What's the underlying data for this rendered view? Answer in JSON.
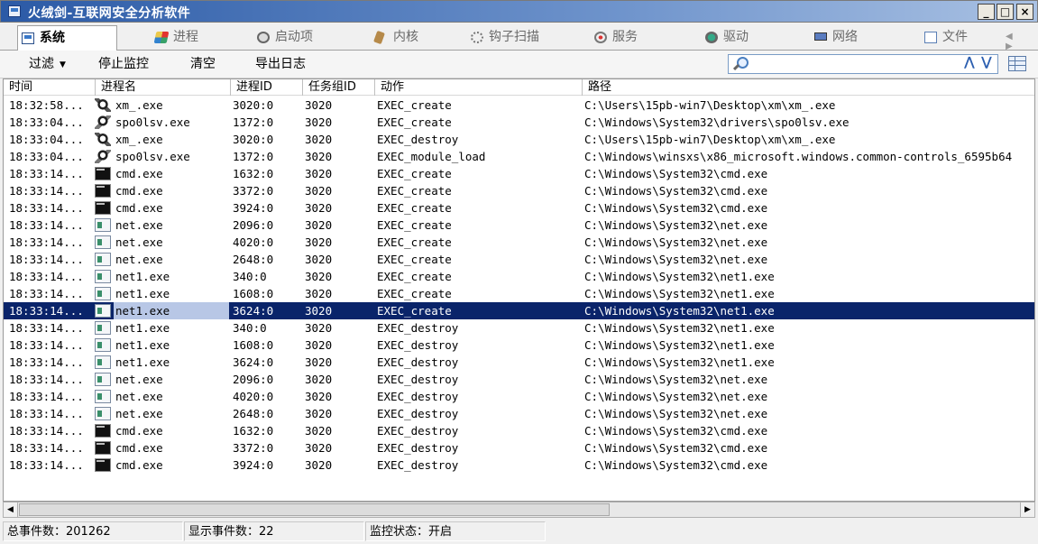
{
  "window": {
    "title": "火绒剑-互联网安全分析软件",
    "buttons": {
      "minimize": "_",
      "maximize": "□",
      "close": "×"
    }
  },
  "tabs": [
    {
      "label": "系统",
      "icon": "system-icon",
      "active": true
    },
    {
      "label": "进程",
      "icon": "process-icon",
      "active": false
    },
    {
      "label": "启动项",
      "icon": "startup-icon",
      "active": false
    },
    {
      "label": "内核",
      "icon": "kernel-icon",
      "active": false
    },
    {
      "label": "钩子扫描",
      "icon": "hook-icon",
      "active": false
    },
    {
      "label": "服务",
      "icon": "service-icon",
      "active": false
    },
    {
      "label": "驱动",
      "icon": "driver-icon",
      "active": false
    },
    {
      "label": "网络",
      "icon": "network-icon",
      "active": false
    },
    {
      "label": "文件",
      "icon": "file-icon",
      "active": false
    }
  ],
  "tab_scroll": "◀ ▶",
  "toolbar": {
    "filter": "过滤",
    "stop_monitor": "停止监控",
    "clear": "清空",
    "export_log": "导出日志",
    "search_value": "",
    "search_up": "⋀",
    "search_down": "⋁"
  },
  "table": {
    "columns": [
      "时间",
      "进程名",
      "进程ID",
      "任务组ID",
      "动作",
      "路径"
    ],
    "selected_index": 12,
    "rows": [
      {
        "time": "18:32:58...",
        "icon": "xm",
        "name": "xm_.exe",
        "pid": "3020:0",
        "tgid": "3020",
        "action": "EXEC_create",
        "path": "C:\\Users\\15pb-win7\\Desktop\\xm\\xm_.exe"
      },
      {
        "time": "18:33:04...",
        "icon": "spool",
        "name": "spo0lsv.exe",
        "pid": "1372:0",
        "tgid": "3020",
        "action": "EXEC_create",
        "path": "C:\\Windows\\System32\\drivers\\spo0lsv.exe"
      },
      {
        "time": "18:33:04...",
        "icon": "xm",
        "name": "xm_.exe",
        "pid": "3020:0",
        "tgid": "3020",
        "action": "EXEC_destroy",
        "path": "C:\\Users\\15pb-win7\\Desktop\\xm\\xm_.exe"
      },
      {
        "time": "18:33:04...",
        "icon": "spool",
        "name": "spo0lsv.exe",
        "pid": "1372:0",
        "tgid": "3020",
        "action": "EXEC_module_load",
        "path": "C:\\Windows\\winsxs\\x86_microsoft.windows.common-controls_6595b64"
      },
      {
        "time": "18:33:14...",
        "icon": "cmd",
        "name": "cmd.exe",
        "pid": "1632:0",
        "tgid": "3020",
        "action": "EXEC_create",
        "path": "C:\\Windows\\System32\\cmd.exe"
      },
      {
        "time": "18:33:14...",
        "icon": "cmd",
        "name": "cmd.exe",
        "pid": "3372:0",
        "tgid": "3020",
        "action": "EXEC_create",
        "path": "C:\\Windows\\System32\\cmd.exe"
      },
      {
        "time": "18:33:14...",
        "icon": "cmd",
        "name": "cmd.exe",
        "pid": "3924:0",
        "tgid": "3020",
        "action": "EXEC_create",
        "path": "C:\\Windows\\System32\\cmd.exe"
      },
      {
        "time": "18:33:14...",
        "icon": "net",
        "name": "net.exe",
        "pid": "2096:0",
        "tgid": "3020",
        "action": "EXEC_create",
        "path": "C:\\Windows\\System32\\net.exe"
      },
      {
        "time": "18:33:14...",
        "icon": "net",
        "name": "net.exe",
        "pid": "4020:0",
        "tgid": "3020",
        "action": "EXEC_create",
        "path": "C:\\Windows\\System32\\net.exe"
      },
      {
        "time": "18:33:14...",
        "icon": "net",
        "name": "net.exe",
        "pid": "2648:0",
        "tgid": "3020",
        "action": "EXEC_create",
        "path": "C:\\Windows\\System32\\net.exe"
      },
      {
        "time": "18:33:14...",
        "icon": "net1",
        "name": "net1.exe",
        "pid": "340:0",
        "tgid": "3020",
        "action": "EXEC_create",
        "path": "C:\\Windows\\System32\\net1.exe"
      },
      {
        "time": "18:33:14...",
        "icon": "net1",
        "name": "net1.exe",
        "pid": "1608:0",
        "tgid": "3020",
        "action": "EXEC_create",
        "path": "C:\\Windows\\System32\\net1.exe"
      },
      {
        "time": "18:33:14...",
        "icon": "net1",
        "name": "net1.exe",
        "pid": "3624:0",
        "tgid": "3020",
        "action": "EXEC_create",
        "path": "C:\\Windows\\System32\\net1.exe"
      },
      {
        "time": "18:33:14...",
        "icon": "net1",
        "name": "net1.exe",
        "pid": "340:0",
        "tgid": "3020",
        "action": "EXEC_destroy",
        "path": "C:\\Windows\\System32\\net1.exe"
      },
      {
        "time": "18:33:14...",
        "icon": "net1",
        "name": "net1.exe",
        "pid": "1608:0",
        "tgid": "3020",
        "action": "EXEC_destroy",
        "path": "C:\\Windows\\System32\\net1.exe"
      },
      {
        "time": "18:33:14...",
        "icon": "net1",
        "name": "net1.exe",
        "pid": "3624:0",
        "tgid": "3020",
        "action": "EXEC_destroy",
        "path": "C:\\Windows\\System32\\net1.exe"
      },
      {
        "time": "18:33:14...",
        "icon": "net",
        "name": "net.exe",
        "pid": "2096:0",
        "tgid": "3020",
        "action": "EXEC_destroy",
        "path": "C:\\Windows\\System32\\net.exe"
      },
      {
        "time": "18:33:14...",
        "icon": "net",
        "name": "net.exe",
        "pid": "4020:0",
        "tgid": "3020",
        "action": "EXEC_destroy",
        "path": "C:\\Windows\\System32\\net.exe"
      },
      {
        "time": "18:33:14...",
        "icon": "net",
        "name": "net.exe",
        "pid": "2648:0",
        "tgid": "3020",
        "action": "EXEC_destroy",
        "path": "C:\\Windows\\System32\\net.exe"
      },
      {
        "time": "18:33:14...",
        "icon": "cmd",
        "name": "cmd.exe",
        "pid": "1632:0",
        "tgid": "3020",
        "action": "EXEC_destroy",
        "path": "C:\\Windows\\System32\\cmd.exe"
      },
      {
        "time": "18:33:14...",
        "icon": "cmd",
        "name": "cmd.exe",
        "pid": "3372:0",
        "tgid": "3020",
        "action": "EXEC_destroy",
        "path": "C:\\Windows\\System32\\cmd.exe"
      },
      {
        "time": "18:33:14...",
        "icon": "cmd",
        "name": "cmd.exe",
        "pid": "3924:0",
        "tgid": "3020",
        "action": "EXEC_destroy",
        "path": "C:\\Windows\\System32\\cmd.exe"
      }
    ]
  },
  "scrollbar": {
    "left": "◀",
    "right": "▶"
  },
  "status": {
    "total": "总事件数：201262",
    "shown": "显示事件数：22",
    "monitor": "监控状态：开启"
  },
  "colors": {
    "selection": "#0a246a",
    "titlebar": "#2b5aa6"
  }
}
